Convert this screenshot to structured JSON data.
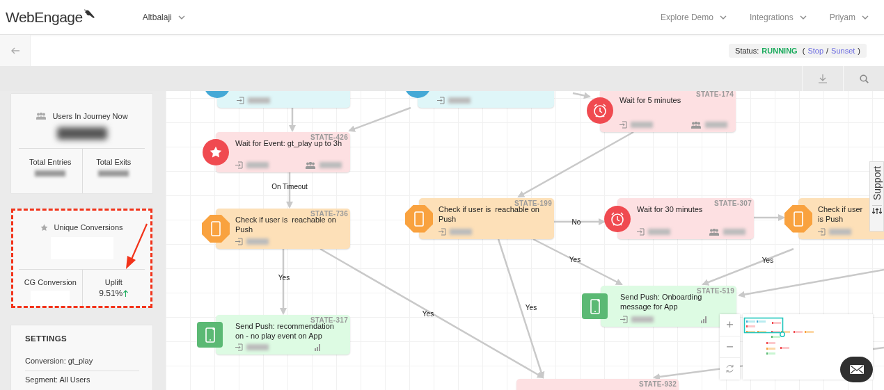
{
  "header": {
    "brand": "WebEngage",
    "workspace": "Altbalaji",
    "nav": [
      {
        "label": "Explore Demo"
      },
      {
        "label": "Integrations"
      },
      {
        "label": "Priyam"
      }
    ]
  },
  "status_bar": {
    "label": "Status:",
    "state": "RUNNING",
    "punctuation": [
      "(",
      "/",
      ")"
    ],
    "actions": [
      {
        "label": "Stop"
      },
      {
        "label": "Sunset"
      }
    ]
  },
  "stats": {
    "users_label": "Users In Journey Now",
    "entries_label": "Total Entries",
    "exits_label": "Total Exits"
  },
  "conversions": {
    "label": "Unique Conversions",
    "cg_label": "CG Conversion",
    "uplift_label": "Uplift",
    "uplift_value": "9.51%",
    "highlighted": true
  },
  "settings": {
    "title": "SETTINGS",
    "items": [
      "Conversion: gt_play",
      "Segment: All Users"
    ]
  },
  "canvas": {
    "nodes": [
      {
        "kind": "entry"
      },
      {
        "kind": "entry"
      },
      {
        "kind": "wait",
        "state": "STATE-174",
        "title": "Wait for 5 minutes"
      },
      {
        "kind": "event",
        "state": "STATE-426",
        "title": "Wait for Event: gt_play up to 3h"
      },
      {
        "kind": "check",
        "state": "STATE-736",
        "title": "Check if user is  reachable on Push"
      },
      {
        "kind": "check",
        "state": "STATE-199",
        "title": "Check if user is  reachable on Push"
      },
      {
        "kind": "wait",
        "state": "STATE-307",
        "title": "Wait for 30 minutes"
      },
      {
        "kind": "check",
        "title": "Check if user is Push"
      },
      {
        "kind": "push",
        "state": "STATE-519",
        "title": "Send Push: Onboarding message for App"
      },
      {
        "kind": "push",
        "state": "STATE-317",
        "title": "Send Push: recommendation on - no play event on App"
      },
      {
        "kind": "wait",
        "state": "STATE-932"
      }
    ],
    "edge_labels": [
      "On Timeout",
      "No",
      "Yes",
      "Yes",
      "Yes",
      "Yes",
      "Yes"
    ],
    "support_label": "Support"
  }
}
